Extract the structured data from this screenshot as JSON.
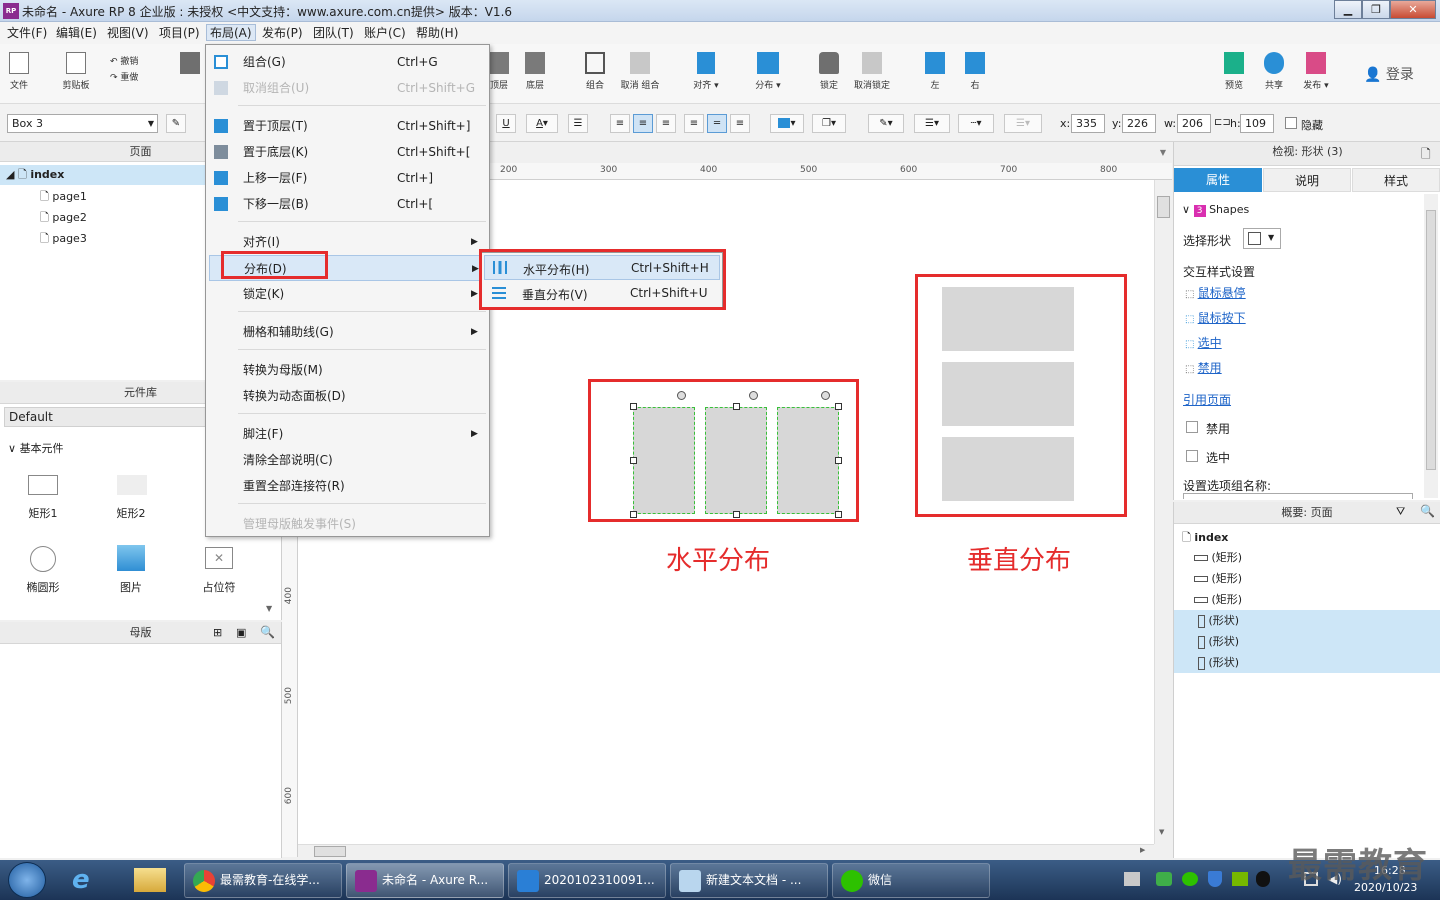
{
  "window": {
    "title": "未命名 - Axure RP 8 企业版 : 未授权    <中文支持：www.axure.com.cn提供> 版本：V1.6",
    "app_icon_label": "RP"
  },
  "menubar": [
    "文件(F)",
    "编辑(E)",
    "视图(V)",
    "项目(P)",
    "布局(A)",
    "发布(P)",
    "团队(T)",
    "账户(C)",
    "帮助(H)"
  ],
  "toolbar": {
    "file": "文件",
    "clipboard": "剪贴板",
    "undo": "撤销",
    "redo": "重做",
    "bring": "顶层",
    "send": "底层",
    "group": "组合",
    "ungroup": "取消 组合",
    "align": "对齐 ▾",
    "distribute": "分布 ▾",
    "lock": "锁定",
    "unlock": "取消锁定",
    "left": "左",
    "right": "右",
    "preview": "预览",
    "share": "共享",
    "publish": "发布 ▾",
    "login": "登录"
  },
  "format_bar": {
    "style_select": "Box 3",
    "x_label": "x:",
    "x": "335",
    "y_label": "y:",
    "y": "226",
    "w_label": "w:",
    "w": "206",
    "h_label": "h:",
    "h": "109",
    "hide_label": "隐藏"
  },
  "pages_panel": {
    "title": "页面",
    "root": "index",
    "pages": [
      "page1",
      "page2",
      "page3"
    ]
  },
  "library_panel": {
    "title": "元件库",
    "library": "Default",
    "section": "基本元件",
    "items": [
      "矩形1",
      "矩形2",
      "椭圆形",
      "图片",
      "占位符"
    ]
  },
  "masters_panel": {
    "title": "母版"
  },
  "layout_menu": {
    "items": [
      {
        "label": "组合(G)",
        "shortcut": "Ctrl+G",
        "disabled": false
      },
      {
        "label": "取消组合(U)",
        "shortcut": "Ctrl+Shift+G",
        "disabled": true
      },
      {
        "label": "置于顶层(T)",
        "shortcut": "Ctrl+Shift+]",
        "disabled": false
      },
      {
        "label": "置于底层(K)",
        "shortcut": "Ctrl+Shift+[",
        "disabled": false
      },
      {
        "label": "上移一层(F)",
        "shortcut": "Ctrl+]",
        "disabled": false
      },
      {
        "label": "下移一层(B)",
        "shortcut": "Ctrl+[",
        "disabled": false
      },
      {
        "label": "对齐(I)",
        "shortcut": "",
        "disabled": false
      },
      {
        "label": "分布(D)",
        "shortcut": "",
        "disabled": false
      },
      {
        "label": "锁定(K)",
        "shortcut": "",
        "disabled": false
      },
      {
        "label": "栅格和辅助线(G)",
        "shortcut": "",
        "disabled": false
      },
      {
        "label": "转换为母版(M)",
        "shortcut": "",
        "disabled": false
      },
      {
        "label": "转换为动态面板(D)",
        "shortcut": "",
        "disabled": false
      },
      {
        "label": "脚注(F)",
        "shortcut": "",
        "disabled": false
      },
      {
        "label": "清除全部说明(C)",
        "shortcut": "",
        "disabled": false
      },
      {
        "label": "重置全部连接符(R)",
        "shortcut": "",
        "disabled": false
      },
      {
        "label": "管理母版触发事件(S)",
        "shortcut": "",
        "disabled": true
      }
    ]
  },
  "distribute_submenu": {
    "items": [
      {
        "label": "水平分布(H)",
        "shortcut": "Ctrl+Shift+H"
      },
      {
        "label": "垂直分布(V)",
        "shortcut": "Ctrl+Shift+U"
      }
    ]
  },
  "ruler": {
    "top": [
      "200",
      "300",
      "400",
      "500",
      "600",
      "700",
      "800"
    ],
    "left": [
      "400",
      "500",
      "600"
    ]
  },
  "canvas": {
    "horizontal_caption": "水平分布",
    "vertical_caption": "垂直分布"
  },
  "inspector": {
    "title": "检视: 形状 (3)",
    "tabs": [
      "属性",
      "说明",
      "样式"
    ],
    "shapes_badge": "3",
    "shapes_label": "Shapes",
    "select_shape": "选择形状",
    "interaction_styles": "交互样式设置",
    "links": [
      "鼠标悬停",
      "鼠标按下",
      "选中",
      "禁用"
    ],
    "ref_page": "引用页面",
    "disabled_label": "禁用",
    "selected_label": "选中",
    "option_group": "设置选项组名称:"
  },
  "outline": {
    "title": "概要: 页面",
    "root": "index",
    "items": [
      "(矩形)",
      "(矩形)",
      "(矩形)",
      "(形状)",
      "(形状)",
      "(形状)"
    ]
  },
  "taskbar": {
    "tasks": [
      "最需教育-在线学...",
      "未命名 - Axure R...",
      "2020102310091...",
      "新建文本文档 - ...",
      "微信"
    ],
    "time": "16:28",
    "date": "2020/10/23",
    "watermark": "最需教育"
  },
  "colors": {
    "accent": "#2a8fd6",
    "highlight_red": "#e52c2c",
    "selection": "#cde6f7"
  }
}
